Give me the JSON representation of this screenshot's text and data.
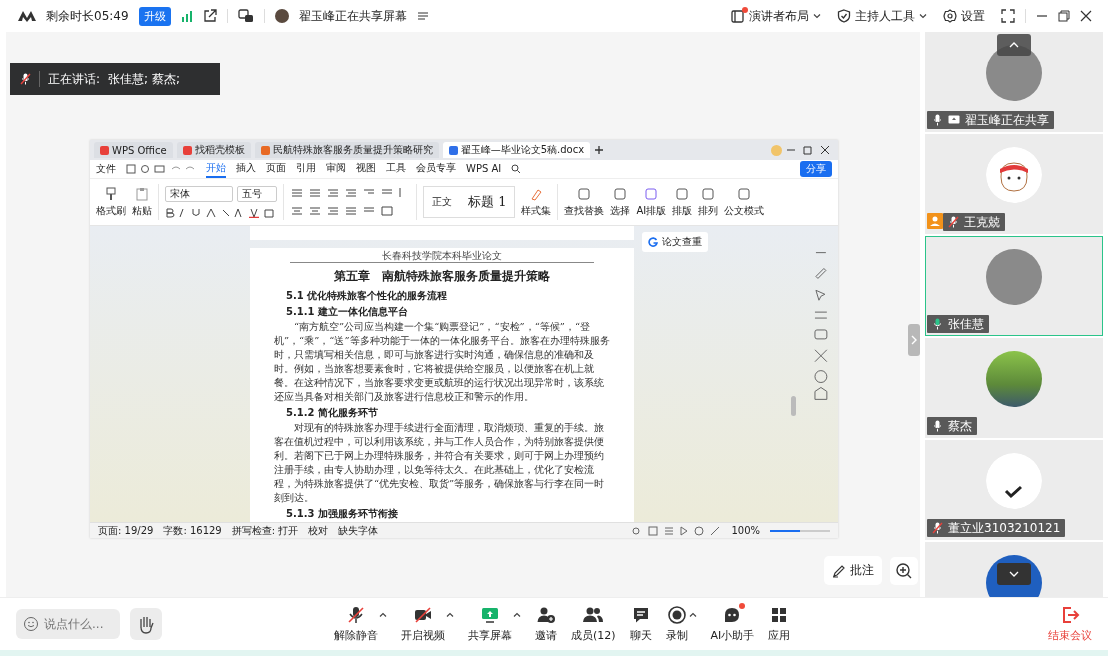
{
  "top_bar": {
    "time_left": "剩余时长05:49",
    "upgrade": "升级",
    "sharing_status": "翟玉峰正在共享屏幕",
    "menus": [
      {
        "label": "演讲者布局",
        "badge_dot": true,
        "dropdown": true
      },
      {
        "label": "主持人工具",
        "badge_dot": false,
        "dropdown": true
      },
      {
        "label": "设置",
        "badge_dot": false,
        "dropdown": false
      }
    ]
  },
  "speaking_banner": {
    "label": "正在讲话:",
    "names": "张佳慧; 蔡杰;"
  },
  "shared_window": {
    "tabs": [
      {
        "label": "WPS Office",
        "selected": false
      },
      {
        "label": "找稻壳模板",
        "selected": false
      },
      {
        "label": "民航特殊旅客服务质量提升策略研究",
        "selected": false
      },
      {
        "label": "翟玉峰—毕业论文5稿.docx",
        "selected": true
      }
    ],
    "file_menu": "文件",
    "ribbon_tabs": [
      {
        "label": "开始",
        "selected": true
      },
      {
        "label": "插入",
        "selected": false
      },
      {
        "label": "页面",
        "selected": false
      },
      {
        "label": "引用",
        "selected": false
      },
      {
        "label": "审阅",
        "selected": false
      },
      {
        "label": "视图",
        "selected": false
      },
      {
        "label": "工具",
        "selected": false
      },
      {
        "label": "会员专享",
        "selected": false
      },
      {
        "label": "WPS AI",
        "selected": false
      }
    ],
    "share": "分享",
    "ribbon": {
      "format_painter": "格式刷",
      "paste": "粘贴",
      "font": "宋体",
      "size": "五号",
      "styles": [
        "正文",
        "标题 1"
      ],
      "style_set": "样式集",
      "tools": [
        "查找替换",
        "选择",
        "AI排版",
        "排版",
        "排列",
        "公文模式"
      ]
    },
    "plagiarism_check": "论文查重",
    "document": {
      "header": "长春科技学院本科毕业论文",
      "title": "第五章　南航特殊旅客服务质量提升策略",
      "blocks": [
        {
          "kind": "heading",
          "text": "5.1 优化特殊旅客个性化的服务流程"
        },
        {
          "kind": "heading",
          "text": "5.1.1 建立一体化信息平台"
        },
        {
          "kind": "paragraph",
          "text": "“南方航空”公司应当构建一个集“购票登记”，“安检”，“等候”，“登机”，“乘”，“送”等多种功能于一体的一体化服务平台。旅客在办理特殊服务时，只需填写相关信息，即可与旅客进行实时沟通，确保信息的准确和及时。例如，当旅客想要素食时，它将被提供给空服员，以便旅客在机上就餐。在这种情况下，当旅客要求变更或航班的运行状况出现异常时，该系统还应当具备对相关部门及旅客进行信息校正和警示的作用。"
        },
        {
          "kind": "heading",
          "text": "5.1.2 简化服务环节"
        },
        {
          "kind": "paragraph",
          "text": "对现有的特殊旅客办理手续进行全面清理，取消烦琐、重复的手续。旅客在值机过程中，可以利用该系统，并与工作人员合作，为特别旅客提供便利。若阁下已于网上办理特殊服务，并符合有关要求，则可于网上办理预约注册手续，由专人协助办理，以免等待太久。在此基础上，优化了安检流程，为特殊旅客提供了“优先安检、取货”等服务，确保旅客与行李在同一时刻到达。"
        },
        {
          "kind": "heading",
          "text": "5.1.3 加强服务环节衔接"
        }
      ]
    },
    "status_bar": {
      "page": "页面: 19/29",
      "words": "字数: 16129",
      "spell": "拼写检查: 打开",
      "proofread": "校对",
      "missing_fonts": "缺失字体",
      "zoom": "100%",
      "zoom_slider": {
        "level": 0.5
      }
    }
  },
  "annotation_tools": {
    "annotate": "批注"
  },
  "participants": [
    {
      "name": "翟玉峰正在共享",
      "muted": false,
      "speaking": false,
      "sharing": true,
      "host": false,
      "selected": false
    },
    {
      "name": "王克兢",
      "muted": true,
      "speaking": false,
      "sharing": false,
      "host": true,
      "selected": false
    },
    {
      "name": "张佳慧",
      "muted": false,
      "speaking": true,
      "sharing": false,
      "host": false,
      "selected": true
    },
    {
      "name": "蔡杰",
      "muted": false,
      "speaking": false,
      "sharing": false,
      "host": false,
      "selected": false
    },
    {
      "name": "董立业3103210121",
      "muted": true,
      "speaking": false,
      "sharing": false,
      "host": false,
      "selected": false
    }
  ],
  "toolbar": {
    "chat_placeholder": "说点什么...",
    "buttons": [
      {
        "label": "解除静音",
        "menu": true,
        "badge_dot": false
      },
      {
        "label": "开启视频",
        "menu": true,
        "badge_dot": false
      },
      {
        "label": "共享屏幕",
        "menu": true,
        "badge_dot": false
      },
      {
        "label": "邀请",
        "menu": false,
        "badge_dot": false
      },
      {
        "label": "成员(12)",
        "menu": false,
        "badge_dot": false
      },
      {
        "label": "聊天",
        "menu": false,
        "badge_dot": false
      },
      {
        "label": "录制",
        "menu": true,
        "badge_dot": false
      },
      {
        "label": "AI小助手",
        "menu": false,
        "badge_dot": true
      },
      {
        "label": "应用",
        "menu": false,
        "badge_dot": false
      }
    ],
    "end": "结束会议"
  }
}
